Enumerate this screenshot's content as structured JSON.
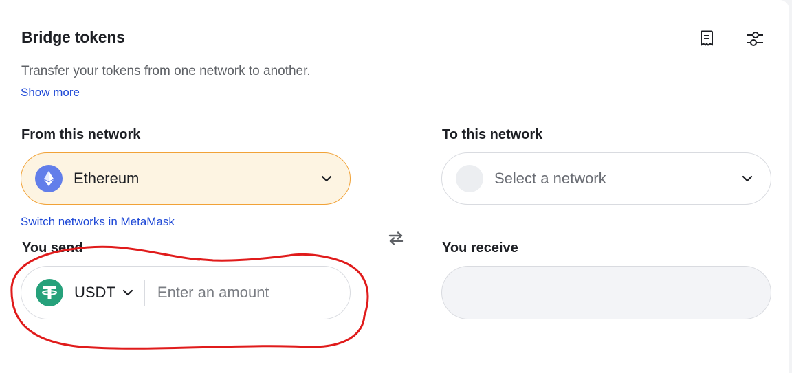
{
  "header": {
    "title": "Bridge tokens",
    "subtitle": "Transfer your tokens from one network to another.",
    "show_more": "Show more",
    "icons": [
      "receipt-icon",
      "settings-sliders-icon"
    ]
  },
  "from": {
    "label": "From this network",
    "network": "Ethereum",
    "network_icon": "ethereum-icon",
    "switch_link": "Switch networks in MetaMask"
  },
  "to": {
    "label": "To this network",
    "placeholder": "Select a network"
  },
  "send": {
    "label": "You send",
    "token": "USDT",
    "token_icon": "tether-icon",
    "amount_value": "",
    "amount_placeholder": "Enter an amount"
  },
  "receive": {
    "label": "You receive",
    "value": ""
  },
  "swap_icon": "swap-arrows-icon",
  "colors": {
    "accent_link": "#1f49d6",
    "from_bg": "#fdf4e2",
    "from_border": "#f1a237",
    "ethereum": "#627eea",
    "tether": "#26a17b",
    "annotation": "#e01b1b"
  }
}
